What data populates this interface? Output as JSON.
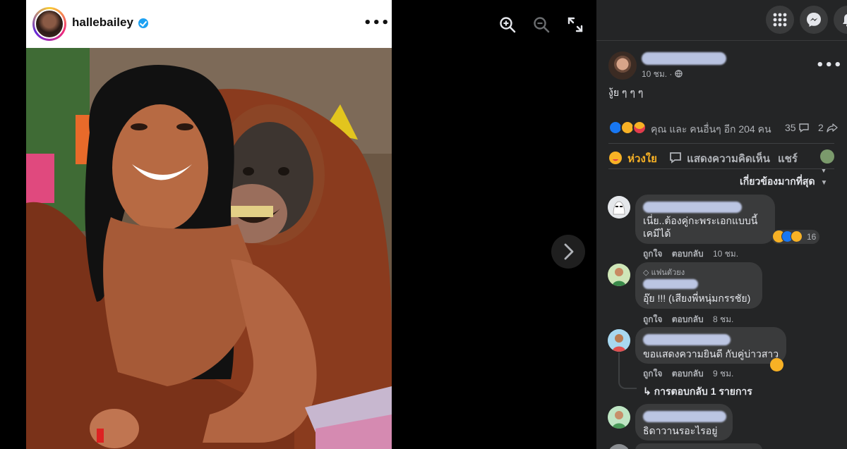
{
  "instagram": {
    "username": "hallebailey",
    "more_label": "•••"
  },
  "viewer": {
    "zoom_in": "zoom-in-icon",
    "zoom_out": "zoom-out-icon",
    "fullscreen": "fullscreen-icon",
    "next": "chevron-right-icon"
  },
  "topbar": {
    "icons": [
      "apps-grid-icon",
      "messenger-icon",
      "notifications-icon"
    ]
  },
  "post": {
    "time": "10 ชม. ·",
    "privacy_icon": "globe-icon",
    "text": "งู้ย ๆ ๆ ๆ",
    "reaction_summary": "คุณ และ คนอื่นๆ อีก 204 คน",
    "comment_count": "35",
    "share_count": "2",
    "actions": {
      "love": "ห่วงใย",
      "comment": "แสดงความคิดเห็น",
      "share": "แชร์"
    },
    "sort_label": "เกี่ยวข้องมากที่สุด"
  },
  "comments": [
    {
      "lines": [
        "เนี่ย..ต้องคู่กะพระเอกแบบนี้",
        "เคมีได้"
      ],
      "like": "ถูกใจ",
      "reply": "ตอบกลับ",
      "time": "10 ชม.",
      "reaction_count": "16"
    },
    {
      "badge": "แฟนตัวยง",
      "lines": [
        "อุ๊ย !!! (เสียงพี่หนุ่มกรรชัย)"
      ],
      "like": "ถูกใจ",
      "reply": "ตอบกลับ",
      "time": "8 ชม."
    },
    {
      "lines": [
        "ขอแสดงความยินดี กับคู่บ่าวสาว"
      ],
      "like": "ถูกใจ",
      "reply": "ตอบกลับ",
      "time": "9 ชม.",
      "replies_label": "↳ การตอบกลับ 1 รายการ"
    },
    {
      "lines": [
        "ธิดาวานรอะไรอยู่"
      ]
    }
  ],
  "colors": {
    "fb_bg": "#242526",
    "bubble": "#3a3b3c",
    "love_accent": "#f33e58",
    "link_blue": "#2d88ff"
  }
}
